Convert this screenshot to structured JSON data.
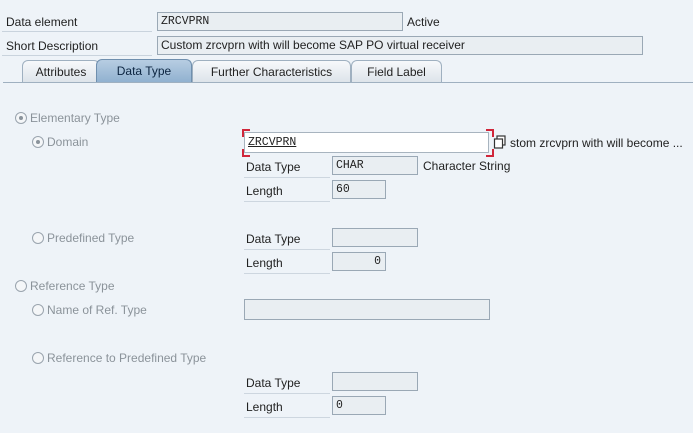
{
  "header": {
    "data_element_label": "Data element",
    "data_element_value": "ZRCVPRN",
    "status": "Active",
    "short_desc_label": "Short Description",
    "short_desc_value": "Custom zrcvprn with will become SAP PO virtual receiver"
  },
  "tabs": [
    {
      "label": "Attributes",
      "active": false
    },
    {
      "label": "Data Type",
      "active": true
    },
    {
      "label": "Further Characteristics",
      "active": false
    },
    {
      "label": "Field Label",
      "active": false
    }
  ],
  "elementary": {
    "label": "Elementary Type",
    "selected": true,
    "domain": {
      "label": "Domain",
      "selected": true,
      "value": "ZRCVPRN",
      "description": "stom zrcvprn with will become ...",
      "data_type_label": "Data Type",
      "data_type_value": "CHAR",
      "data_type_desc": "Character String",
      "length_label": "Length",
      "length_value": "60"
    },
    "predefined": {
      "label": "Predefined Type",
      "selected": false,
      "data_type_label": "Data Type",
      "data_type_value": "",
      "length_label": "Length",
      "length_value": "0"
    }
  },
  "reference": {
    "label": "Reference Type",
    "selected": false,
    "name_of_ref": {
      "label": "Name of Ref. Type",
      "selected": false,
      "value": ""
    },
    "ref_predefined": {
      "label": "Reference to Predefined Type",
      "selected": false,
      "data_type_label": "Data Type",
      "data_type_value": "",
      "length_label": "Length",
      "length_value": "0"
    }
  },
  "icons": {
    "value_help": "copy-icon"
  }
}
